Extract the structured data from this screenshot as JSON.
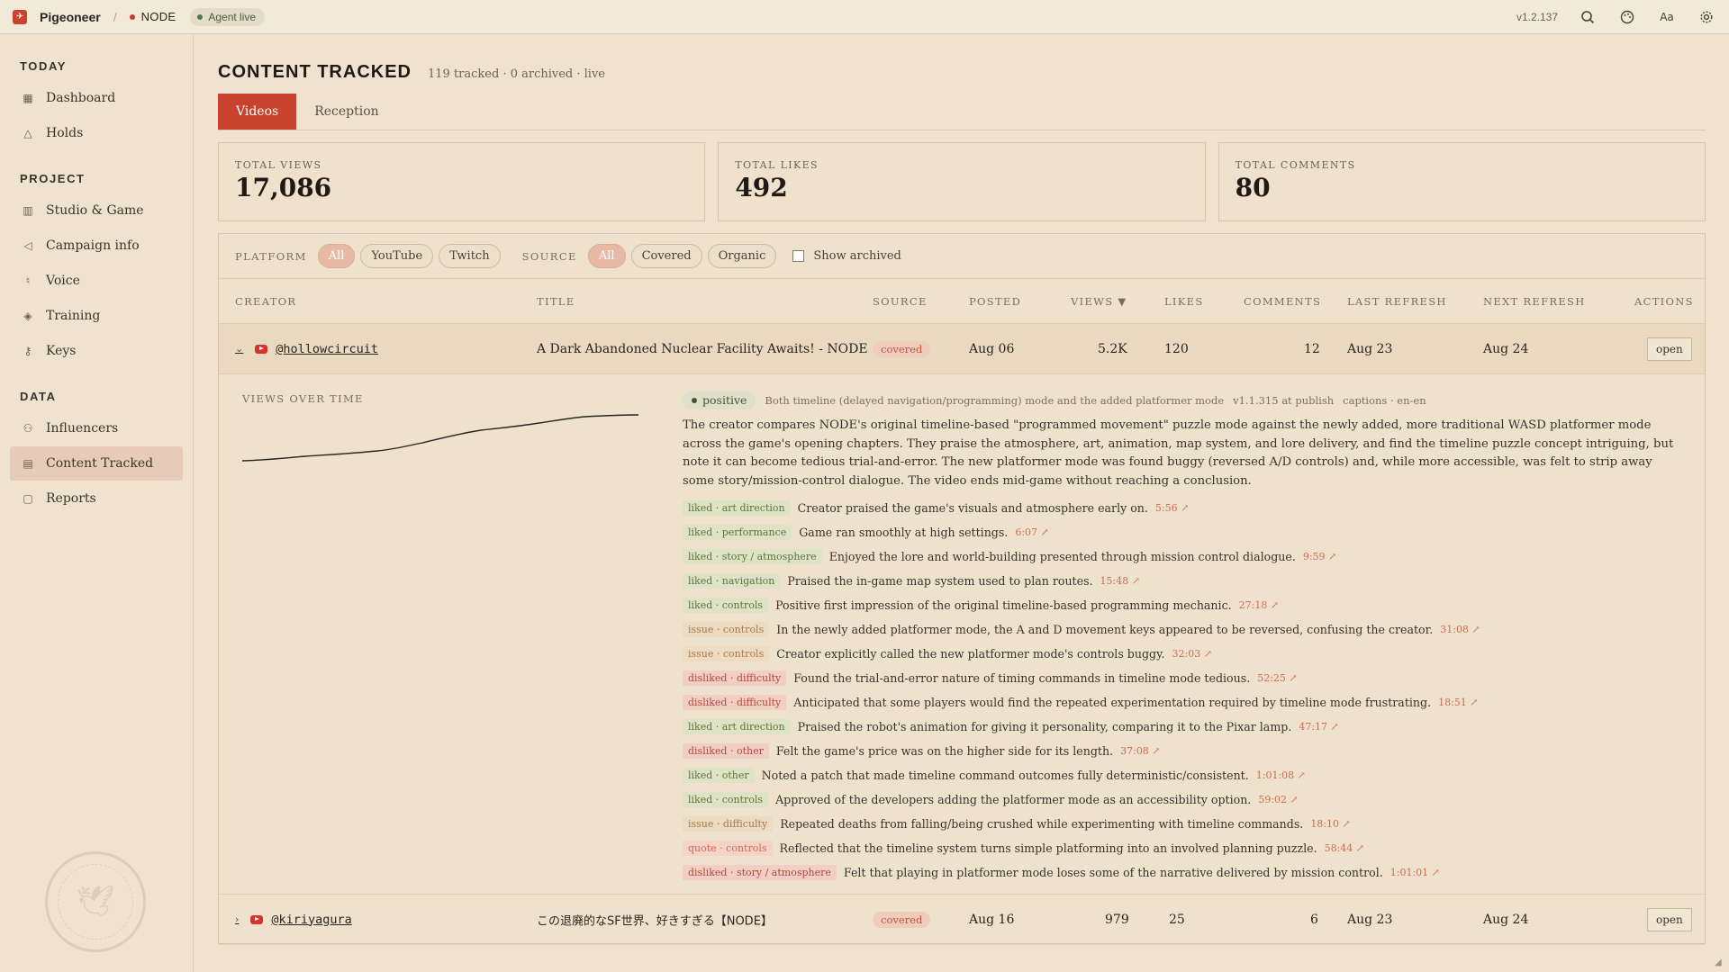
{
  "topbar": {
    "brand": "Pigeoneer",
    "separator": "/",
    "project": "NODE",
    "agent_status": "Agent live",
    "version": "v1.2.137",
    "font_button": "Aa",
    "icons": [
      "search-icon",
      "palette-icon",
      "font-size-icon",
      "gear-icon"
    ]
  },
  "sidebar": {
    "sections": [
      {
        "title": "TODAY",
        "items": [
          {
            "label": "Dashboard",
            "icon": "grid-icon"
          },
          {
            "label": "Holds",
            "icon": "warning-icon"
          }
        ]
      },
      {
        "title": "PROJECT",
        "items": [
          {
            "label": "Studio & Game",
            "icon": "building-icon"
          },
          {
            "label": "Campaign info",
            "icon": "megaphone-icon"
          },
          {
            "label": "Voice",
            "icon": "microphone-icon"
          },
          {
            "label": "Training",
            "icon": "graduation-icon"
          },
          {
            "label": "Keys",
            "icon": "key-icon"
          }
        ]
      },
      {
        "title": "DATA",
        "items": [
          {
            "label": "Influencers",
            "icon": "users-icon"
          },
          {
            "label": "Content Tracked",
            "icon": "bar-chart-icon",
            "active": true
          },
          {
            "label": "Reports",
            "icon": "document-icon"
          }
        ]
      }
    ],
    "stamp_text": "PIGEONEER AIR MAIL"
  },
  "page": {
    "title": "CONTENT TRACKED",
    "subtitle": "119 tracked · 0 archived · live",
    "tabs": [
      "Videos",
      "Reception"
    ],
    "active_tab": "Videos"
  },
  "stats": [
    {
      "label": "TOTAL VIEWS",
      "value": "17,086"
    },
    {
      "label": "TOTAL LIKES",
      "value": "492"
    },
    {
      "label": "TOTAL COMMENTS",
      "value": "80"
    }
  ],
  "filters": {
    "platform_label": "PLATFORM",
    "platform_options": [
      "All",
      "YouTube",
      "Twitch"
    ],
    "platform_selected": "All",
    "source_label": "SOURCE",
    "source_options": [
      "All",
      "Covered",
      "Organic"
    ],
    "source_selected": "All",
    "show_archived_label": "Show archived",
    "show_archived": false
  },
  "table": {
    "columns": {
      "creator": "CREATOR",
      "title": "TITLE",
      "source": "SOURCE",
      "posted": "POSTED",
      "views": "VIEWS ▼",
      "likes": "LIKES",
      "comments": "COMMENTS",
      "last_refresh": "LAST REFRESH",
      "next_refresh": "NEXT REFRESH",
      "actions": "ACTIONS"
    },
    "rows": [
      {
        "creator": "@hollowcircuit",
        "title": "A Dark Abandoned Nuclear Facility Awaits! - NODE",
        "source": "covered",
        "posted": "Aug 06",
        "views": "5.2K",
        "likes": "120",
        "comments": "12",
        "last_refresh": "Aug 23",
        "next_refresh": "Aug 24",
        "action": "open",
        "expanded": true
      },
      {
        "creator": "@kiriyagura",
        "title": "この退廃的なSF世界、好きすぎる【NODE】",
        "source": "covered",
        "posted": "Aug 16",
        "views": "979",
        "likes": "25",
        "comments": "6",
        "last_refresh": "Aug 23",
        "next_refresh": "Aug 24",
        "action": "open",
        "expanded": false
      }
    ]
  },
  "detail": {
    "views_over_time_label": "VIEWS OVER TIME",
    "sentiment": "positive",
    "context": "Both timeline (delayed navigation/programming) mode and the added platformer mode",
    "version_note": "v1.1.315 at publish",
    "captions": "captions · en-en",
    "summary": "The creator compares NODE's original timeline-based \"programmed movement\" puzzle mode against the newly added, more traditional WASD platformer mode across the game's opening chapters. They praise the atmosphere, art, animation, map system, and lore delivery, and find the timeline puzzle concept intriguing, but note it can become tedious trial-and-error. The new platformer mode was found buggy (reversed A/D controls) and, while more accessible, was felt to strip away some story/mission-control dialogue. The video ends mid-game without reaching a conclusion.",
    "feedback": [
      {
        "tag": "liked · art direction",
        "kind": "liked",
        "text": "Creator praised the game's visuals and atmosphere early on.",
        "ts": "5:56 ↗"
      },
      {
        "tag": "liked · performance",
        "kind": "liked",
        "text": "Game ran smoothly at high settings.",
        "ts": "6:07 ↗"
      },
      {
        "tag": "liked · story / atmosphere",
        "kind": "liked",
        "text": "Enjoyed the lore and world-building presented through mission control dialogue.",
        "ts": "9:59 ↗"
      },
      {
        "tag": "liked · navigation",
        "kind": "liked",
        "text": "Praised the in-game map system used to plan routes.",
        "ts": "15:48 ↗"
      },
      {
        "tag": "liked · controls",
        "kind": "liked",
        "text": "Positive first impression of the original timeline-based programming mechanic.",
        "ts": "27:18 ↗"
      },
      {
        "tag": "issue · controls",
        "kind": "issue",
        "text": "In the newly added platformer mode, the A and D movement keys appeared to be reversed, confusing the creator.",
        "ts": "31:08 ↗"
      },
      {
        "tag": "issue · controls",
        "kind": "issue",
        "text": "Creator explicitly called the new platformer mode's controls buggy.",
        "ts": "32:03 ↗"
      },
      {
        "tag": "disliked · difficulty",
        "kind": "disliked",
        "text": "Found the trial-and-error nature of timing commands in timeline mode tedious.",
        "ts": "52:25 ↗"
      },
      {
        "tag": "disliked · difficulty",
        "kind": "disliked",
        "text": "Anticipated that some players would find the repeated experimentation required by timeline mode frustrating.",
        "ts": "18:51 ↗"
      },
      {
        "tag": "liked · art direction",
        "kind": "liked",
        "text": "Praised the robot's animation for giving it personality, comparing it to the Pixar lamp.",
        "ts": "47:17 ↗"
      },
      {
        "tag": "disliked · other",
        "kind": "disliked",
        "text": "Felt the game's price was on the higher side for its length.",
        "ts": "37:08 ↗"
      },
      {
        "tag": "liked · other",
        "kind": "liked",
        "text": "Noted a patch that made timeline command outcomes fully deterministic/consistent.",
        "ts": "1:01:08 ↗"
      },
      {
        "tag": "liked · controls",
        "kind": "liked",
        "text": "Approved of the developers adding the platformer mode as an accessibility option.",
        "ts": "59:02 ↗"
      },
      {
        "tag": "issue · difficulty",
        "kind": "issue",
        "text": "Repeated deaths from falling/being crushed while experimenting with timeline commands.",
        "ts": "18:10 ↗"
      },
      {
        "tag": "quote · controls",
        "kind": "quote",
        "text": "Reflected that the timeline system turns simple platforming into an involved planning puzzle.",
        "ts": "58:44 ↗"
      },
      {
        "tag": "disliked · story / atmosphere",
        "kind": "disliked",
        "text": "Felt that playing in platformer mode loses some of the narrative delivered by mission control.",
        "ts": "1:01:01 ↗"
      }
    ]
  },
  "colors": {
    "accent": "#c8432e",
    "background": "#efe3cf",
    "liked": "#60733c",
    "disliked": "#b3473a",
    "issue": "#a27a4a"
  }
}
